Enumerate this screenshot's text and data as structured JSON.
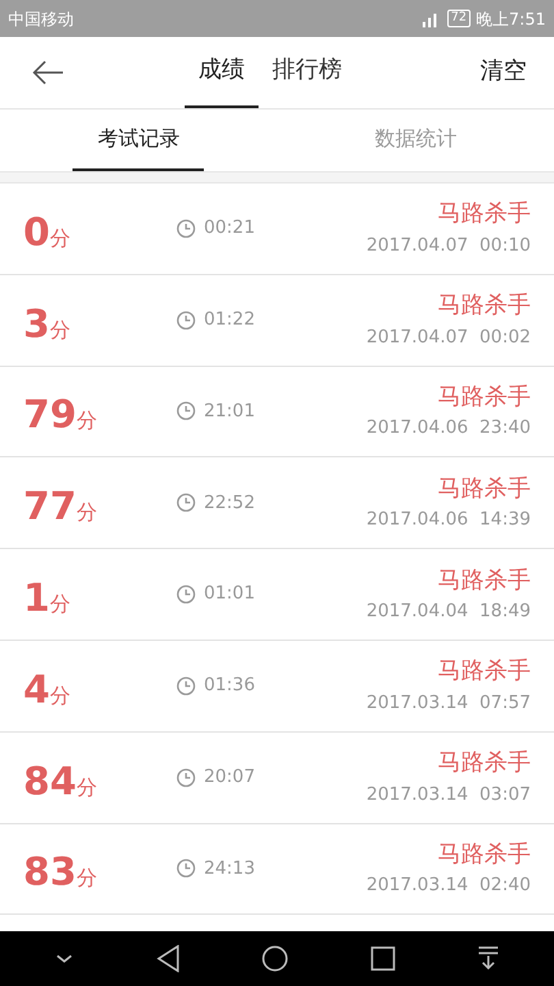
{
  "status_bar": {
    "carrier": "中国移动",
    "battery": "72",
    "time": "晚上7:51"
  },
  "header": {
    "tabs": [
      {
        "label": "成绩",
        "selected": true
      },
      {
        "label": "排行榜",
        "selected": false
      }
    ],
    "action": "清空"
  },
  "subtabs": [
    {
      "label": "考试记录",
      "selected": true
    },
    {
      "label": "数据统计",
      "selected": false
    }
  ],
  "records": [
    {
      "score": "0",
      "unit": "分",
      "duration": "00:21",
      "name": "马路杀手",
      "date": "2017.04.07  00:10"
    },
    {
      "score": "3",
      "unit": "分",
      "duration": "01:22",
      "name": "马路杀手",
      "date": "2017.04.07  00:02"
    },
    {
      "score": "79",
      "unit": "分",
      "duration": "21:01",
      "name": "马路杀手",
      "date": "2017.04.06  23:40"
    },
    {
      "score": "77",
      "unit": "分",
      "duration": "22:52",
      "name": "马路杀手",
      "date": "2017.04.06  14:39"
    },
    {
      "score": "1",
      "unit": "分",
      "duration": "01:01",
      "name": "马路杀手",
      "date": "2017.04.04  18:49"
    },
    {
      "score": "4",
      "unit": "分",
      "duration": "01:36",
      "name": "马路杀手",
      "date": "2017.03.14  07:57"
    },
    {
      "score": "84",
      "unit": "分",
      "duration": "20:07",
      "name": "马路杀手",
      "date": "2017.03.14  03:07"
    },
    {
      "score": "83",
      "unit": "分",
      "duration": "24:13",
      "name": "马路杀手",
      "date": "2017.03.14  02:40"
    }
  ]
}
